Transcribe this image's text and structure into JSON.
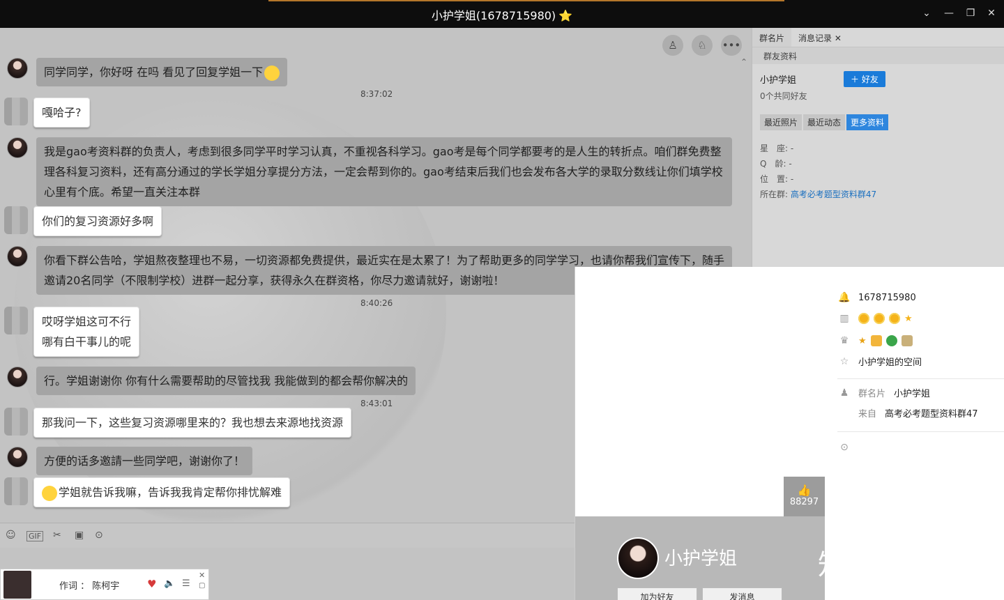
{
  "window": {
    "title": "小护学姐(1678715980)",
    "title_star": "⭐"
  },
  "chat": {
    "messages": [
      {
        "sender": "them",
        "text": "同学同学，你好呀 在吗  看见了回复学姐一下"
      },
      {
        "type": "time",
        "text": "8:37:02"
      },
      {
        "sender": "me",
        "text": "嘎哈子?"
      },
      {
        "sender": "them",
        "text": "我是gao考资料群的负责人，考虑到很多同学平时学习认真，不重视各科学习。gao考是每个同学都要考的是人生的转折点。咱们群免费整理各科复习资料，还有高分通过的学长学姐分享提分方法，一定会帮到你的。gao考结束后我们也会发布各大学的录取分数线让你们填学校心里有个底。希望一直关注本群"
      },
      {
        "sender": "me",
        "text": "你们的复习资源好多啊"
      },
      {
        "sender": "them",
        "text": "你看下群公告哈，学姐熬夜整理也不易，一切资源都免费提供，最近实在是太累了！为了帮助更多的同学学习，也请你帮我们宣传下，随手邀请20名同学（不限制学校）进群一起分享，获得永久在群资格，你尽力邀请就好，谢谢啦！"
      },
      {
        "type": "time",
        "text": "8:40:26"
      },
      {
        "sender": "me",
        "text_line1": "哎呀学姐这可不行",
        "text_line2": "哪有白干事儿的呢"
      },
      {
        "sender": "them",
        "text": "行。学姐谢谢你 你有什么需要帮助的尽管找我 我能做到的都会帮你解决的"
      },
      {
        "type": "time",
        "text": "8:43:01"
      },
      {
        "sender": "me",
        "text": "那我问一下，这些复习资源哪里来的？我也想去来源地找资源"
      },
      {
        "sender": "them",
        "text": "方便的话多邀請一些同学吧，谢谢你了！"
      },
      {
        "sender": "me",
        "text": "学姐就告诉我嘛，告诉我我肯定帮你排忧解难"
      }
    ],
    "toolbar_icons": [
      "emoji-icon",
      "gif-icon",
      "scissors-icon",
      "image-icon",
      "more-icon"
    ]
  },
  "player": {
    "lyric": "作词 ： 陈柯宇"
  },
  "side_panel": {
    "tabs": [
      "群名片",
      "消息记录"
    ],
    "sub_header": "群友资料",
    "name": "小护学姐",
    "add_friend": "好友",
    "mutual_friends": "0个共同好友",
    "subtabs": [
      "最近照片",
      "最近动态",
      "更多资料"
    ],
    "fields": [
      {
        "label": "星　座:",
        "value": "-"
      },
      {
        "label": "Q　龄:",
        "value": "-"
      },
      {
        "label": "位　置:",
        "value": "-"
      }
    ],
    "group_label": "所在群:",
    "group_value": "高考必考题型资料群47"
  },
  "profile_popup": {
    "qq": "1678715980",
    "likes": "88297",
    "name": "小护学姐",
    "space": "小护学姐的空间",
    "group_card_label": "群名片",
    "group_card_value": "小护学姐",
    "from_label": "来自",
    "from_value": "高考必考题型资料群47",
    "btn_add": "加为好友",
    "btn_msg": "发消息"
  },
  "watermark": "知乎 @西游",
  "colors": {
    "accent": "#1a7bd9",
    "bubble_dark": "#a4a4a4",
    "bubble_light": "#ffffff"
  }
}
